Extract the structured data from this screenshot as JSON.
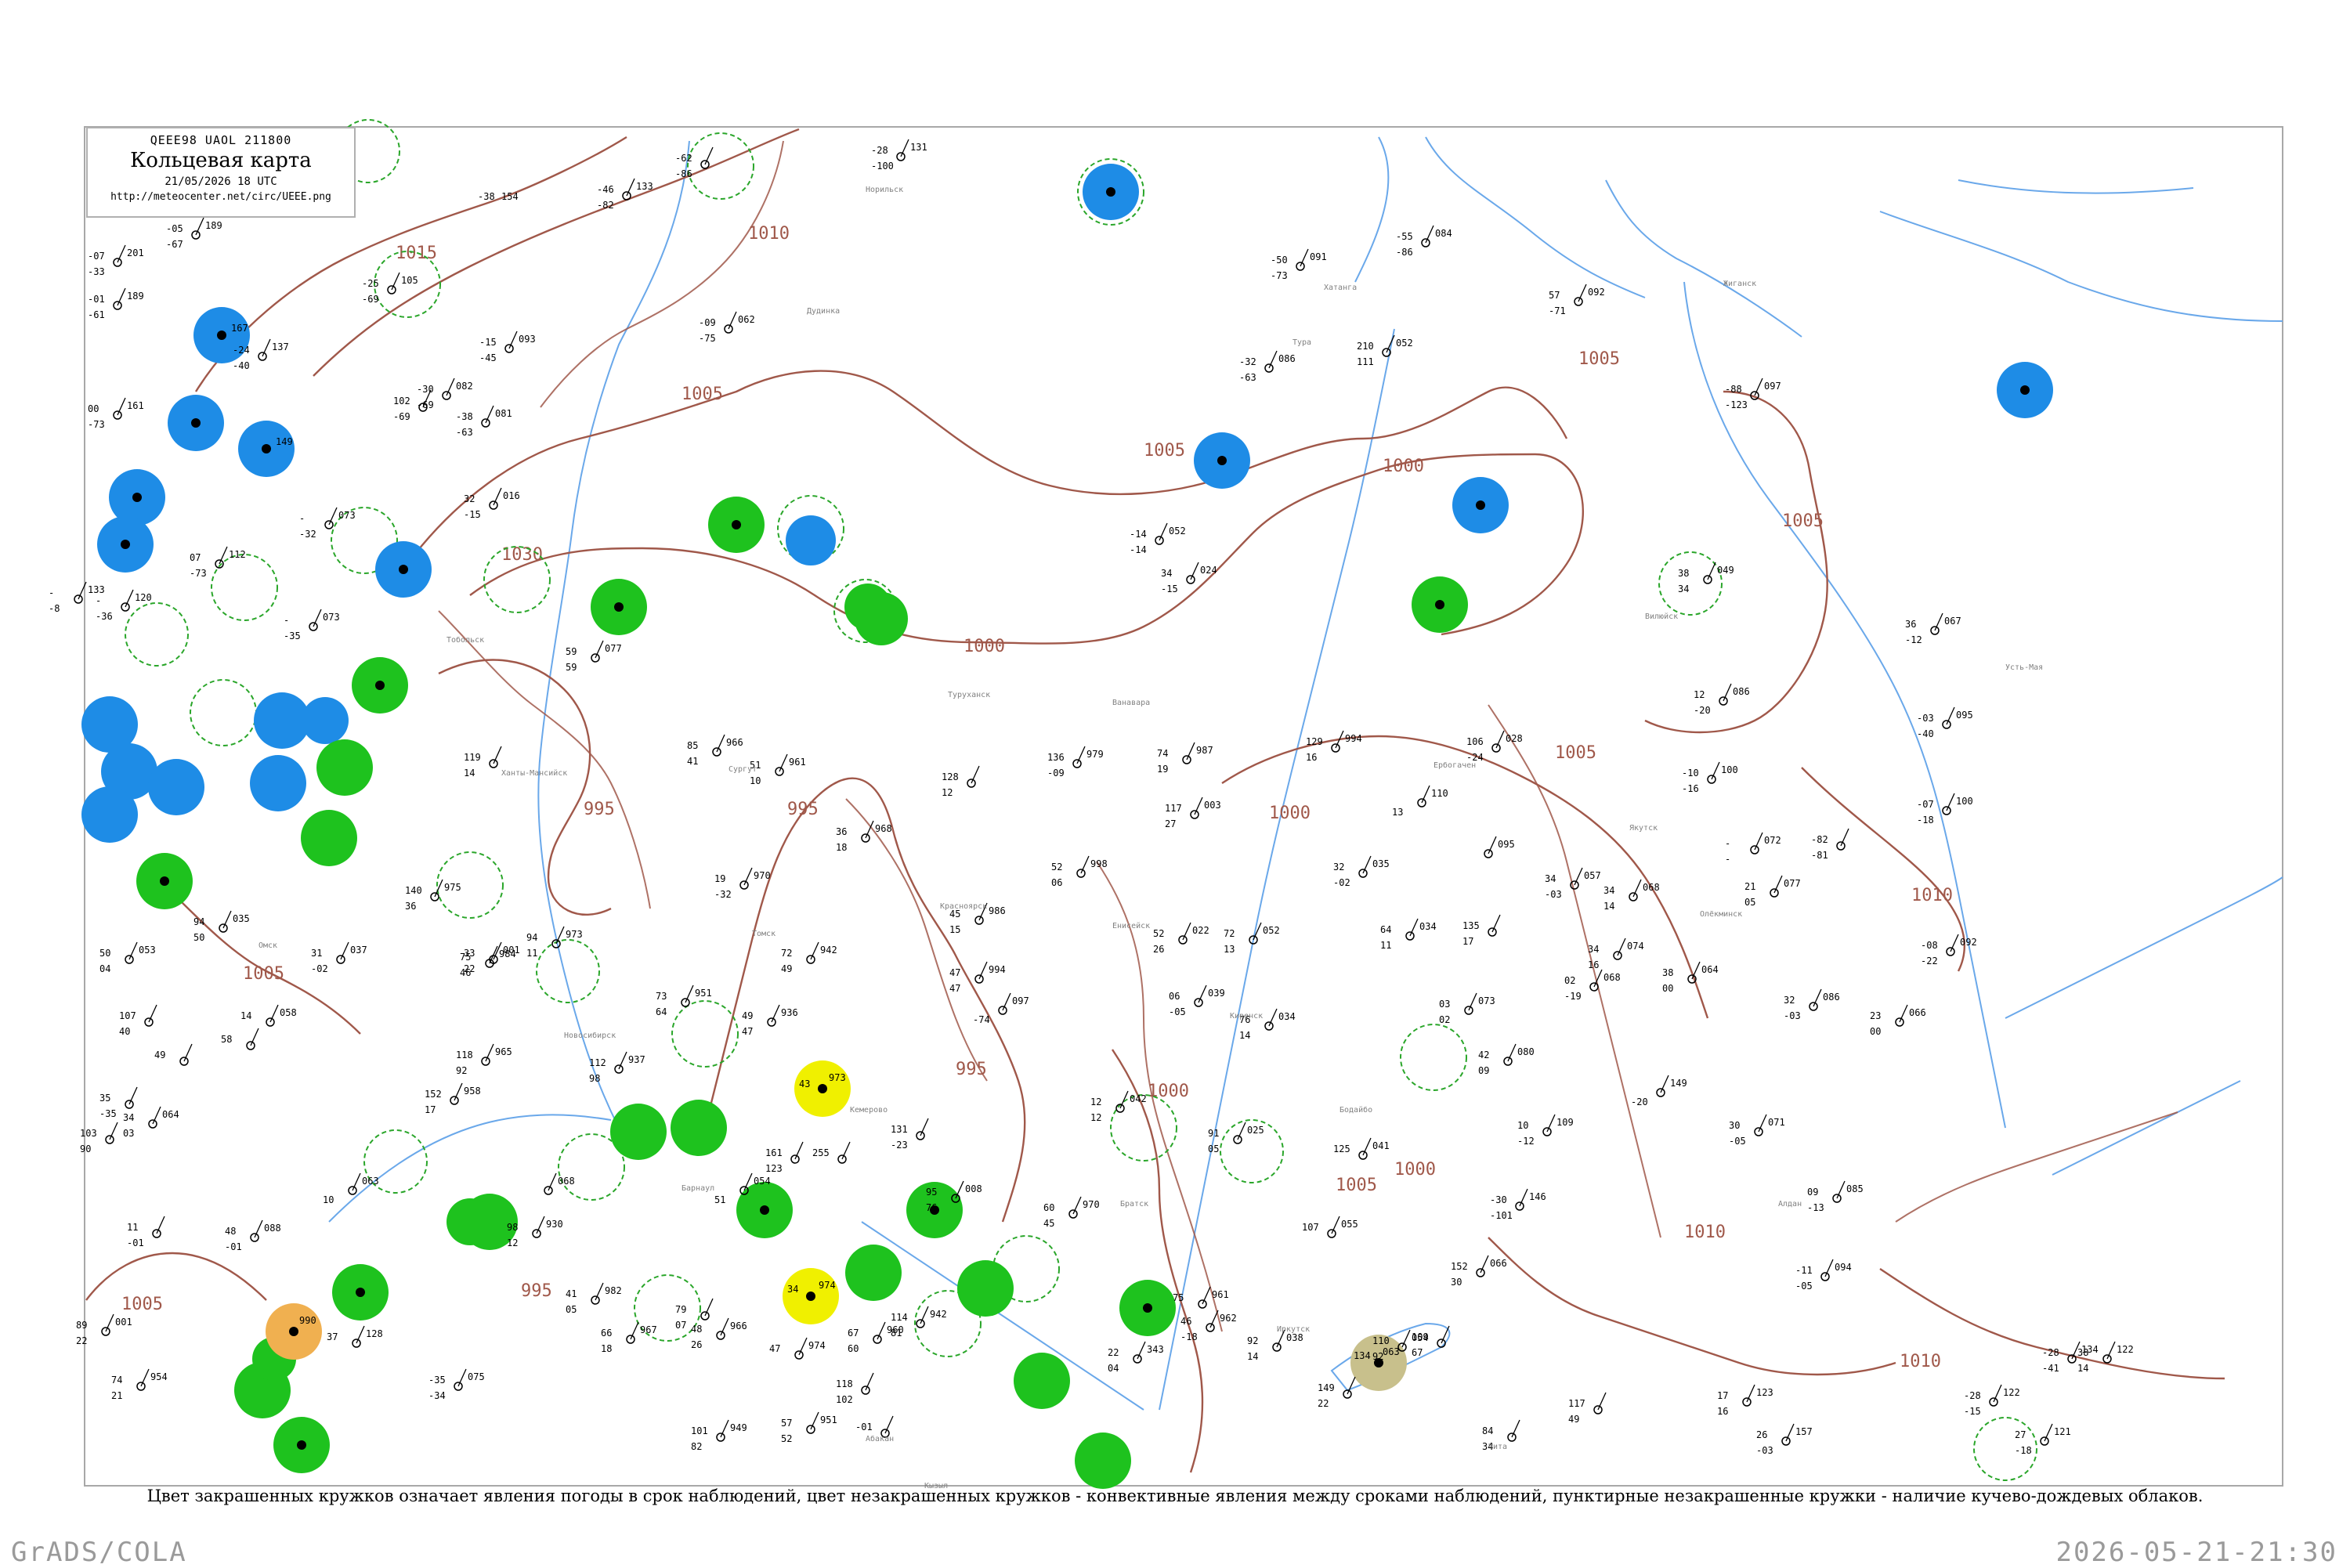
{
  "header": {
    "code": "QEEE98  UAOL  211800",
    "title": "Кольцевая карта",
    "date": "21/05/2026 18 UTC",
    "url": "http://meteocenter.net/circ/UEEE.png"
  },
  "caption": "Цвет закрашенных кружков означает явления погоды в срок наблюдений, цвет незакрашенных кружков - конвективные явления между сроками наблюдений, пунктирные незакрашенные кружки - наличие кучево-дождевых облаков.",
  "footer": {
    "left": "GrADS/COLA",
    "right": "2026-05-21-21:30"
  },
  "colors": {
    "rain": "#1ec21e",
    "snow": "#1e8ce6",
    "fog": "#f0f000",
    "dust": "#f0b050",
    "haze": "#c8c08c",
    "isobar": "#a0584a",
    "water": "#5aa0e6",
    "cb": "#2aa62a"
  },
  "isobars": [
    {
      "label": "1015"
    },
    {
      "label": "1010"
    },
    {
      "label": "1005"
    },
    {
      "label": "1030"
    },
    {
      "label": "1005"
    },
    {
      "label": "1000"
    },
    {
      "label": "1000"
    },
    {
      "label": "995"
    },
    {
      "label": "995"
    },
    {
      "label": "995"
    },
    {
      "label": "1005"
    },
    {
      "label": "1000"
    },
    {
      "label": "1000"
    },
    {
      "label": "1005"
    },
    {
      "label": "1010"
    },
    {
      "label": "1005"
    },
    {
      "label": "1010"
    },
    {
      "label": "1005"
    },
    {
      "label": "1010"
    },
    {
      "label": "995"
    },
    {
      "label": "1005"
    },
    {
      "label": "1000"
    },
    {
      "label": "1005"
    }
  ],
  "stations": [
    {
      "kind": "snow",
      "id": "23242",
      "t": "-38",
      "p": "154"
    },
    {
      "kind": "snow",
      "id": "",
      "t": "",
      "p": "167"
    },
    {
      "kind": "snow",
      "id": "",
      "t": "",
      "p": ""
    },
    {
      "kind": "snow",
      "id": "",
      "t": "",
      "p": "149"
    },
    {
      "kind": "snow",
      "id": "",
      "t": "",
      "p": ""
    },
    {
      "kind": "snow",
      "id": "",
      "t": "",
      "p": ""
    },
    {
      "kind": "snow",
      "id": "",
      "t": "",
      "p": ""
    },
    {
      "kind": "snow",
      "id": "",
      "t": "",
      "p": ""
    },
    {
      "kind": "snow",
      "id": "",
      "t": "",
      "p": ""
    },
    {
      "kind": "snow",
      "id": "",
      "t": "",
      "p": ""
    },
    {
      "kind": "snow",
      "id": "",
      "t": "",
      "p": ""
    },
    {
      "kind": "snow",
      "id": "",
      "t": "",
      "p": ""
    },
    {
      "kind": "snow",
      "id": "",
      "t": "",
      "p": ""
    },
    {
      "kind": "snow",
      "id": "",
      "t": "",
      "p": ""
    },
    {
      "kind": "snow",
      "id": "",
      "t": "",
      "p": ""
    },
    {
      "kind": "snow",
      "id": "",
      "t": "",
      "p": ""
    },
    {
      "kind": "snow",
      "id": "",
      "t": "",
      "p": ""
    },
    {
      "kind": "snow",
      "id": "",
      "t": "",
      "p": ""
    },
    {
      "kind": "rain",
      "id": "",
      "t": "",
      "p": ""
    },
    {
      "kind": "rain",
      "id": "",
      "t": "",
      "p": ""
    },
    {
      "kind": "rain",
      "id": "",
      "t": "",
      "p": ""
    },
    {
      "kind": "rain",
      "id": "",
      "t": "",
      "p": ""
    },
    {
      "kind": "rain",
      "id": "",
      "t": "",
      "p": ""
    },
    {
      "kind": "rain",
      "id": "",
      "t": "",
      "p": ""
    },
    {
      "kind": "rain",
      "id": "",
      "t": "",
      "p": ""
    },
    {
      "kind": "rain",
      "id": "",
      "t": "",
      "p": ""
    },
    {
      "kind": "rain",
      "id": "",
      "t": "",
      "p": ""
    },
    {
      "kind": "rain",
      "id": "",
      "t": "",
      "p": ""
    },
    {
      "kind": "rain",
      "id": "",
      "t": "",
      "p": ""
    },
    {
      "kind": "rain",
      "id": "",
      "t": "",
      "p": ""
    },
    {
      "kind": "rain",
      "id": "",
      "t": "",
      "p": ""
    },
    {
      "kind": "rain",
      "id": "",
      "t": "",
      "p": ""
    },
    {
      "kind": "rain",
      "id": "",
      "t": "",
      "p": ""
    },
    {
      "kind": "rain",
      "id": "",
      "t": "",
      "p": ""
    },
    {
      "kind": "rain",
      "id": "",
      "t": "",
      "p": ""
    },
    {
      "kind": "rain",
      "id": "",
      "t": "",
      "p": ""
    },
    {
      "kind": "rain",
      "id": "",
      "t": "",
      "p": ""
    },
    {
      "kind": "rain",
      "id": "",
      "t": "",
      "p": ""
    },
    {
      "kind": "rain",
      "id": "",
      "t": "",
      "p": ""
    },
    {
      "kind": "rain",
      "id": "",
      "t": "",
      "p": ""
    },
    {
      "kind": "rain",
      "id": "",
      "t": "",
      "p": ""
    },
    {
      "kind": "rain",
      "id": "",
      "t": "",
      "p": ""
    },
    {
      "kind": "fog",
      "id": "",
      "t": "43",
      "p": "973"
    },
    {
      "kind": "fog",
      "id": "",
      "t": "34",
      "p": "974"
    },
    {
      "kind": "dust",
      "id": "",
      "t": "",
      "p": "990"
    },
    {
      "kind": "haze",
      "id": "",
      "t": "134",
      "p": "063"
    }
  ],
  "cb_rings": [
    {
      "id": "1"
    },
    {
      "id": "2"
    },
    {
      "id": "3"
    },
    {
      "id": "4"
    },
    {
      "id": "5"
    },
    {
      "id": "6"
    },
    {
      "id": "7"
    },
    {
      "id": "8"
    },
    {
      "id": "9"
    },
    {
      "id": "10"
    },
    {
      "id": "11"
    },
    {
      "id": "12"
    },
    {
      "id": "13"
    },
    {
      "id": "14"
    },
    {
      "id": "15"
    },
    {
      "id": "16"
    },
    {
      "id": "17"
    },
    {
      "id": "18"
    },
    {
      "id": "19"
    },
    {
      "id": "20"
    },
    {
      "id": "21"
    },
    {
      "id": "22"
    },
    {
      "id": "23"
    },
    {
      "id": "24"
    }
  ],
  "obs": [
    {
      "t": "-46",
      "p": "133",
      "d": "-82"
    },
    {
      "t": "-28",
      "p": "131",
      "d": "-100"
    },
    {
      "t": "-62",
      "p": "",
      "d": "-86"
    },
    {
      "t": "-05",
      "p": "189",
      "d": "-67"
    },
    {
      "t": "-07",
      "p": "201",
      "d": "-33"
    },
    {
      "t": "-01",
      "p": "189",
      "d": "-61"
    },
    {
      "t": "-25",
      "p": "105",
      "d": "-69"
    },
    {
      "t": "-09",
      "p": "062",
      "d": "-75"
    },
    {
      "t": "-55",
      "p": "084",
      "d": "-86"
    },
    {
      "t": "57",
      "p": "092",
      "d": "-71"
    },
    {
      "t": "-50",
      "p": "091",
      "d": "-73"
    },
    {
      "t": "210",
      "p": "052",
      "d": "111"
    },
    {
      "t": "-15",
      "p": "093",
      "d": "-45"
    },
    {
      "t": "-32",
      "p": "086",
      "d": "-63"
    },
    {
      "t": "-24",
      "p": "137",
      "d": "-40"
    },
    {
      "t": "00",
      "p": "161",
      "d": "-73"
    },
    {
      "t": "-30",
      "p": "082",
      "d": "-69"
    },
    {
      "t": "102",
      "p": "",
      "d": "-69"
    },
    {
      "t": "-38",
      "p": "081",
      "d": "-63"
    },
    {
      "t": "-88",
      "p": "097",
      "d": "-123"
    },
    {
      "t": "32",
      "p": "016",
      "d": "-15"
    },
    {
      "t": "-14",
      "p": "052",
      "d": "-14"
    },
    {
      "t": "34",
      "p": "024",
      "d": "-15"
    },
    {
      "t": "07",
      "p": "112",
      "d": "-73"
    },
    {
      "t": "-",
      "p": "073",
      "d": "-32"
    },
    {
      "t": "-",
      "p": "073",
      "d": "-35"
    },
    {
      "t": "-",
      "p": "133",
      "d": "-8"
    },
    {
      "t": "-",
      "p": "120",
      "d": "-36"
    },
    {
      "t": "38",
      "p": "049",
      "d": "34"
    },
    {
      "t": "36",
      "p": "067",
      "d": "-12"
    },
    {
      "t": "59",
      "p": "077",
      "d": "59"
    },
    {
      "t": "85",
      "p": "966",
      "d": "41"
    },
    {
      "t": "51",
      "p": "961",
      "d": "10"
    },
    {
      "t": "128",
      "p": "",
      "d": "12"
    },
    {
      "t": "136",
      "p": "979",
      "d": "-09"
    },
    {
      "t": "74",
      "p": "987",
      "d": "19"
    },
    {
      "t": "129",
      "p": "994",
      "d": "16"
    },
    {
      "t": "106",
      "p": "028",
      "d": "-24"
    },
    {
      "t": "12",
      "p": "086",
      "d": "-20"
    },
    {
      "t": "-03",
      "p": "095",
      "d": "-40"
    },
    {
      "t": "-10",
      "p": "100",
      "d": "-16"
    },
    {
      "t": "-07",
      "p": "100",
      "d": "-18"
    },
    {
      "t": "119",
      "p": "",
      "d": "14"
    },
    {
      "t": "117",
      "p": "003",
      "d": "27"
    },
    {
      "t": "36",
      "p": "968",
      "d": "18"
    },
    {
      "t": "52",
      "p": "998",
      "d": "06"
    },
    {
      "t": "32",
      "p": "035",
      "d": "-02"
    },
    {
      "t": "34",
      "p": "057",
      "d": "-03"
    },
    {
      "t": "34",
      "p": "068",
      "d": "14"
    },
    {
      "t": "21",
      "p": "077",
      "d": "05"
    },
    {
      "t": "-82",
      "p": "",
      "d": "-81"
    },
    {
      "t": "-",
      "p": "072",
      "d": "-"
    },
    {
      "t": "19",
      "p": "970",
      "d": "-32"
    },
    {
      "t": "45",
      "p": "986",
      "d": "15"
    },
    {
      "t": "72",
      "p": "942",
      "d": "49"
    },
    {
      "t": "47",
      "p": "994",
      "d": "47"
    },
    {
      "t": "52",
      "p": "022",
      "d": "26"
    },
    {
      "t": "72",
      "p": "052",
      "d": "13"
    },
    {
      "t": "64",
      "p": "034",
      "d": "11"
    },
    {
      "t": "135",
      "p": "",
      "d": "17"
    },
    {
      "t": "34",
      "p": "074",
      "d": "16"
    },
    {
      "t": "38",
      "p": "064",
      "d": "00"
    },
    {
      "t": "-08",
      "p": "092",
      "d": "-22"
    },
    {
      "t": "94",
      "p": "973",
      "d": "11"
    },
    {
      "t": "75",
      "p": "984",
      "d": "46"
    },
    {
      "t": "33",
      "p": "001",
      "d": "22"
    },
    {
      "t": "140",
      "p": "975",
      "d": "36"
    },
    {
      "t": "31",
      "p": "037",
      "d": "-02"
    },
    {
      "t": "94",
      "p": "035",
      "d": "50"
    },
    {
      "t": "50",
      "p": "053",
      "d": "04"
    },
    {
      "t": "107",
      "p": "",
      "d": "40"
    },
    {
      "t": "14",
      "p": "058",
      "d": ""
    },
    {
      "t": "49",
      "p": "",
      "d": ""
    },
    {
      "t": "58",
      "p": "",
      "d": ""
    },
    {
      "t": "73",
      "p": "951",
      "d": "64"
    },
    {
      "t": "49",
      "p": "936",
      "d": "47"
    },
    {
      "t": "112",
      "p": "937",
      "d": "98"
    },
    {
      "t": "118",
      "p": "965",
      "d": "92"
    },
    {
      "t": "152",
      "p": "958",
      "d": "17"
    },
    {
      "t": "06",
      "p": "039",
      "d": "-05"
    },
    {
      "t": "76",
      "p": "034",
      "d": "14"
    },
    {
      "t": "131",
      "p": "",
      "d": "-23"
    },
    {
      "t": "161",
      "p": "",
      "d": "123"
    },
    {
      "t": "255",
      "p": "",
      "d": ""
    },
    {
      "t": "03",
      "p": "073",
      "d": "02"
    },
    {
      "t": "42",
      "p": "080",
      "d": "09"
    },
    {
      "t": "10",
      "p": "109",
      "d": "-12"
    },
    {
      "t": "30",
      "p": "071",
      "d": "-05"
    },
    {
      "t": "23",
      "p": "066",
      "d": "00"
    },
    {
      "t": "32",
      "p": "086",
      "d": "-03"
    },
    {
      "t": "02",
      "p": "068",
      "d": "-19"
    },
    {
      "t": "12",
      "p": "042",
      "d": "12"
    },
    {
      "t": "91",
      "p": "025",
      "d": "05"
    },
    {
      "t": "125",
      "p": "041",
      "d": ""
    },
    {
      "t": "107",
      "p": "055",
      "d": ""
    },
    {
      "t": "-30",
      "p": "146",
      "d": "-101"
    },
    {
      "t": "09",
      "p": "085",
      "d": "-13"
    },
    {
      "t": "-11",
      "p": "094",
      "d": "-05"
    },
    {
      "t": "152",
      "p": "066",
      "d": "30"
    },
    {
      "t": "35",
      "p": "",
      "d": "-35"
    },
    {
      "t": "34",
      "p": "064",
      "d": "03"
    },
    {
      "t": "103",
      "p": "",
      "d": "90"
    },
    {
      "t": "11",
      "p": "",
      "d": "-01"
    },
    {
      "t": "48",
      "p": "088",
      "d": "-01"
    },
    {
      "t": "89",
      "p": "001",
      "d": "22"
    },
    {
      "t": "37",
      "p": "128",
      "d": ""
    },
    {
      "t": "74",
      "p": "954",
      "d": "21"
    },
    {
      "t": "-35",
      "p": "075",
      "d": "-34"
    },
    {
      "t": "98",
      "p": "930",
      "d": "12"
    },
    {
      "t": "41",
      "p": "982",
      "d": "05"
    },
    {
      "t": "66",
      "p": "967",
      "d": "18"
    },
    {
      "t": "79",
      "p": "",
      "d": "07"
    },
    {
      "t": "48",
      "p": "966",
      "d": "26"
    },
    {
      "t": "47",
      "p": "974",
      "d": ""
    },
    {
      "t": "67",
      "p": "960",
      "d": "60"
    },
    {
      "t": "114",
      "p": "942",
      "d": "81"
    },
    {
      "t": "118",
      "p": "",
      "d": "102"
    },
    {
      "t": "57",
      "p": "951",
      "d": "52"
    },
    {
      "t": "101",
      "p": "949",
      "d": "82"
    },
    {
      "t": "75",
      "p": "961",
      "d": ""
    },
    {
      "t": "46",
      "p": "962",
      "d": "-18"
    },
    {
      "t": "92",
      "p": "038",
      "d": "14"
    },
    {
      "t": "110",
      "p": "054",
      "d": "92"
    },
    {
      "t": "109",
      "p": "",
      "d": "67"
    },
    {
      "t": "149",
      "p": "",
      "d": "22"
    },
    {
      "t": "84",
      "p": "",
      "d": "34"
    },
    {
      "t": "117",
      "p": "",
      "d": "49"
    },
    {
      "t": "17",
      "p": "123",
      "d": "16"
    },
    {
      "t": "26",
      "p": "157",
      "d": "-03"
    },
    {
      "t": "-28",
      "p": "134",
      "d": "-41"
    },
    {
      "t": "38",
      "p": "122",
      "d": "14"
    },
    {
      "t": "27",
      "p": "121",
      "d": "-18"
    },
    {
      "t": "-28",
      "p": "122",
      "d": "-15"
    },
    {
      "t": "22",
      "p": "343",
      "d": "04"
    },
    {
      "t": "-01",
      "p": "",
      "d": ""
    },
    {
      "t": "95",
      "p": "008",
      "d": "76"
    },
    {
      "t": "60",
      "p": "970",
      "d": "45"
    },
    {
      "t": "",
      "p": "097",
      "d": "-74"
    },
    {
      "t": "",
      "p": "149",
      "d": "-20"
    },
    {
      "t": "",
      "p": "110",
      "d": "13"
    },
    {
      "t": "",
      "p": "095",
      "d": ""
    },
    {
      "t": "",
      "p": "063",
      "d": "10"
    },
    {
      "t": "",
      "p": "068",
      "d": ""
    },
    {
      "t": "",
      "p": "054",
      "d": "51"
    }
  ],
  "places": [
    {
      "name": "Ханты-Мансийск"
    },
    {
      "name": "Сургут"
    },
    {
      "name": "Тобольск"
    },
    {
      "name": "Омск"
    },
    {
      "name": "Новосибирск"
    },
    {
      "name": "Томск"
    },
    {
      "name": "Красноярск"
    },
    {
      "name": "Барнаул"
    },
    {
      "name": "Кемерово"
    },
    {
      "name": "Иркутск"
    },
    {
      "name": "Норильск"
    },
    {
      "name": "Дудинка"
    },
    {
      "name": "Туруханск"
    },
    {
      "name": "Енисейск"
    },
    {
      "name": "Абакан"
    },
    {
      "name": "Кызыл"
    },
    {
      "name": "Братск"
    },
    {
      "name": "Бодайбо"
    },
    {
      "name": "Киренск"
    },
    {
      "name": "Ванавара"
    },
    {
      "name": "Ербогачен"
    },
    {
      "name": "Тура"
    },
    {
      "name": "Хатанга"
    },
    {
      "name": "Якутск"
    },
    {
      "name": "Олёкминск"
    },
    {
      "name": "Алдан"
    },
    {
      "name": "Чита"
    },
    {
      "name": "Усть-Мая"
    },
    {
      "name": "Вилюйск"
    },
    {
      "name": "Жиганск"
    }
  ]
}
